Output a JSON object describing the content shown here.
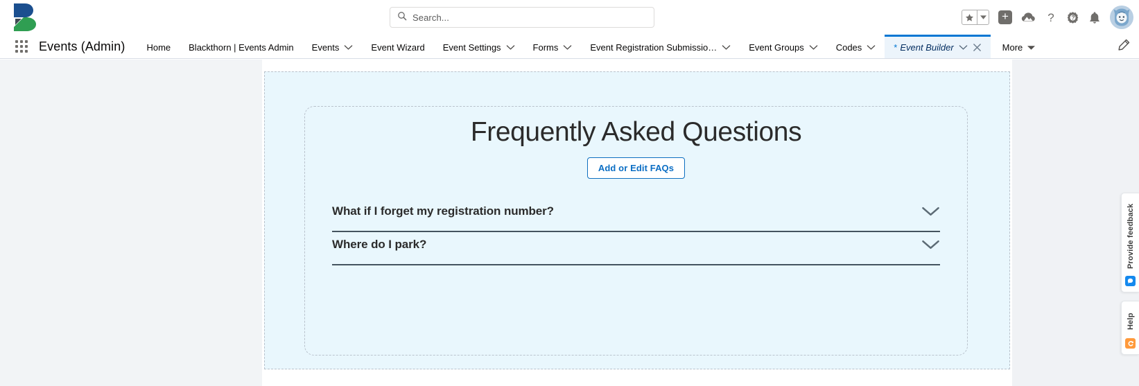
{
  "header": {
    "logo_alt": "blackthorn-logo",
    "search": {
      "placeholder": "Search...",
      "value": "",
      "icon": "search-icon"
    },
    "utilities": [
      {
        "name": "favorites-star",
        "icon": "star-icon"
      },
      {
        "name": "favorites-dropdown",
        "icon": "caret-down-icon"
      },
      {
        "name": "global-create",
        "icon": "plus-icon"
      },
      {
        "name": "app-launcher-cloud",
        "icon": "cloud-mountain-icon"
      },
      {
        "name": "help",
        "icon": "question-mark-icon"
      },
      {
        "name": "setup",
        "icon": "gear-icon"
      },
      {
        "name": "notifications",
        "icon": "bell-icon"
      },
      {
        "name": "user-avatar",
        "icon": "avatar-icon"
      }
    ]
  },
  "app_nav": {
    "app_launcher_icon": "waffle-grid-icon",
    "app_name": "Events (Admin)",
    "tabs": [
      {
        "label": "Home",
        "has_dropdown": false,
        "active": false
      },
      {
        "label": "Blackthorn | Events Admin",
        "has_dropdown": false,
        "active": false
      },
      {
        "label": "Events",
        "has_dropdown": true,
        "active": false
      },
      {
        "label": "Event Wizard",
        "has_dropdown": false,
        "active": false
      },
      {
        "label": "Event Settings",
        "has_dropdown": true,
        "active": false
      },
      {
        "label": "Forms",
        "has_dropdown": true,
        "active": false
      },
      {
        "label": "Event Registration Submissio…",
        "has_dropdown": true,
        "active": false
      },
      {
        "label": "Event Groups",
        "has_dropdown": true,
        "active": false
      },
      {
        "label": "Codes",
        "has_dropdown": true,
        "active": false
      },
      {
        "label": "Event Builder",
        "has_dropdown": true,
        "active": true,
        "unsaved_marker": "*",
        "closable": true
      }
    ],
    "more_label": "More",
    "edit_icon": "pencil-icon"
  },
  "main": {
    "faq": {
      "title": "Frequently Asked Questions",
      "edit_button_label": "Add or Edit FAQs",
      "items": [
        {
          "question": "What if I forget my registration number?",
          "expanded": false,
          "toggle_icon": "chevron-down-icon"
        },
        {
          "question": "Where do I park?",
          "expanded": false,
          "toggle_icon": "chevron-down-icon"
        }
      ]
    }
  },
  "side_tabs": [
    {
      "label": "Provide feedback",
      "icon": "feedback-badge-icon",
      "color": "#1589ee"
    },
    {
      "label": "Help",
      "icon": "help-badge-icon",
      "color": "#ff9a3c"
    }
  ],
  "colors": {
    "brand_blue": "#0176d3",
    "canvas_blue": "#e9f7fd",
    "link_blue": "#0b6ec4",
    "divider_dark": "#44545f"
  }
}
